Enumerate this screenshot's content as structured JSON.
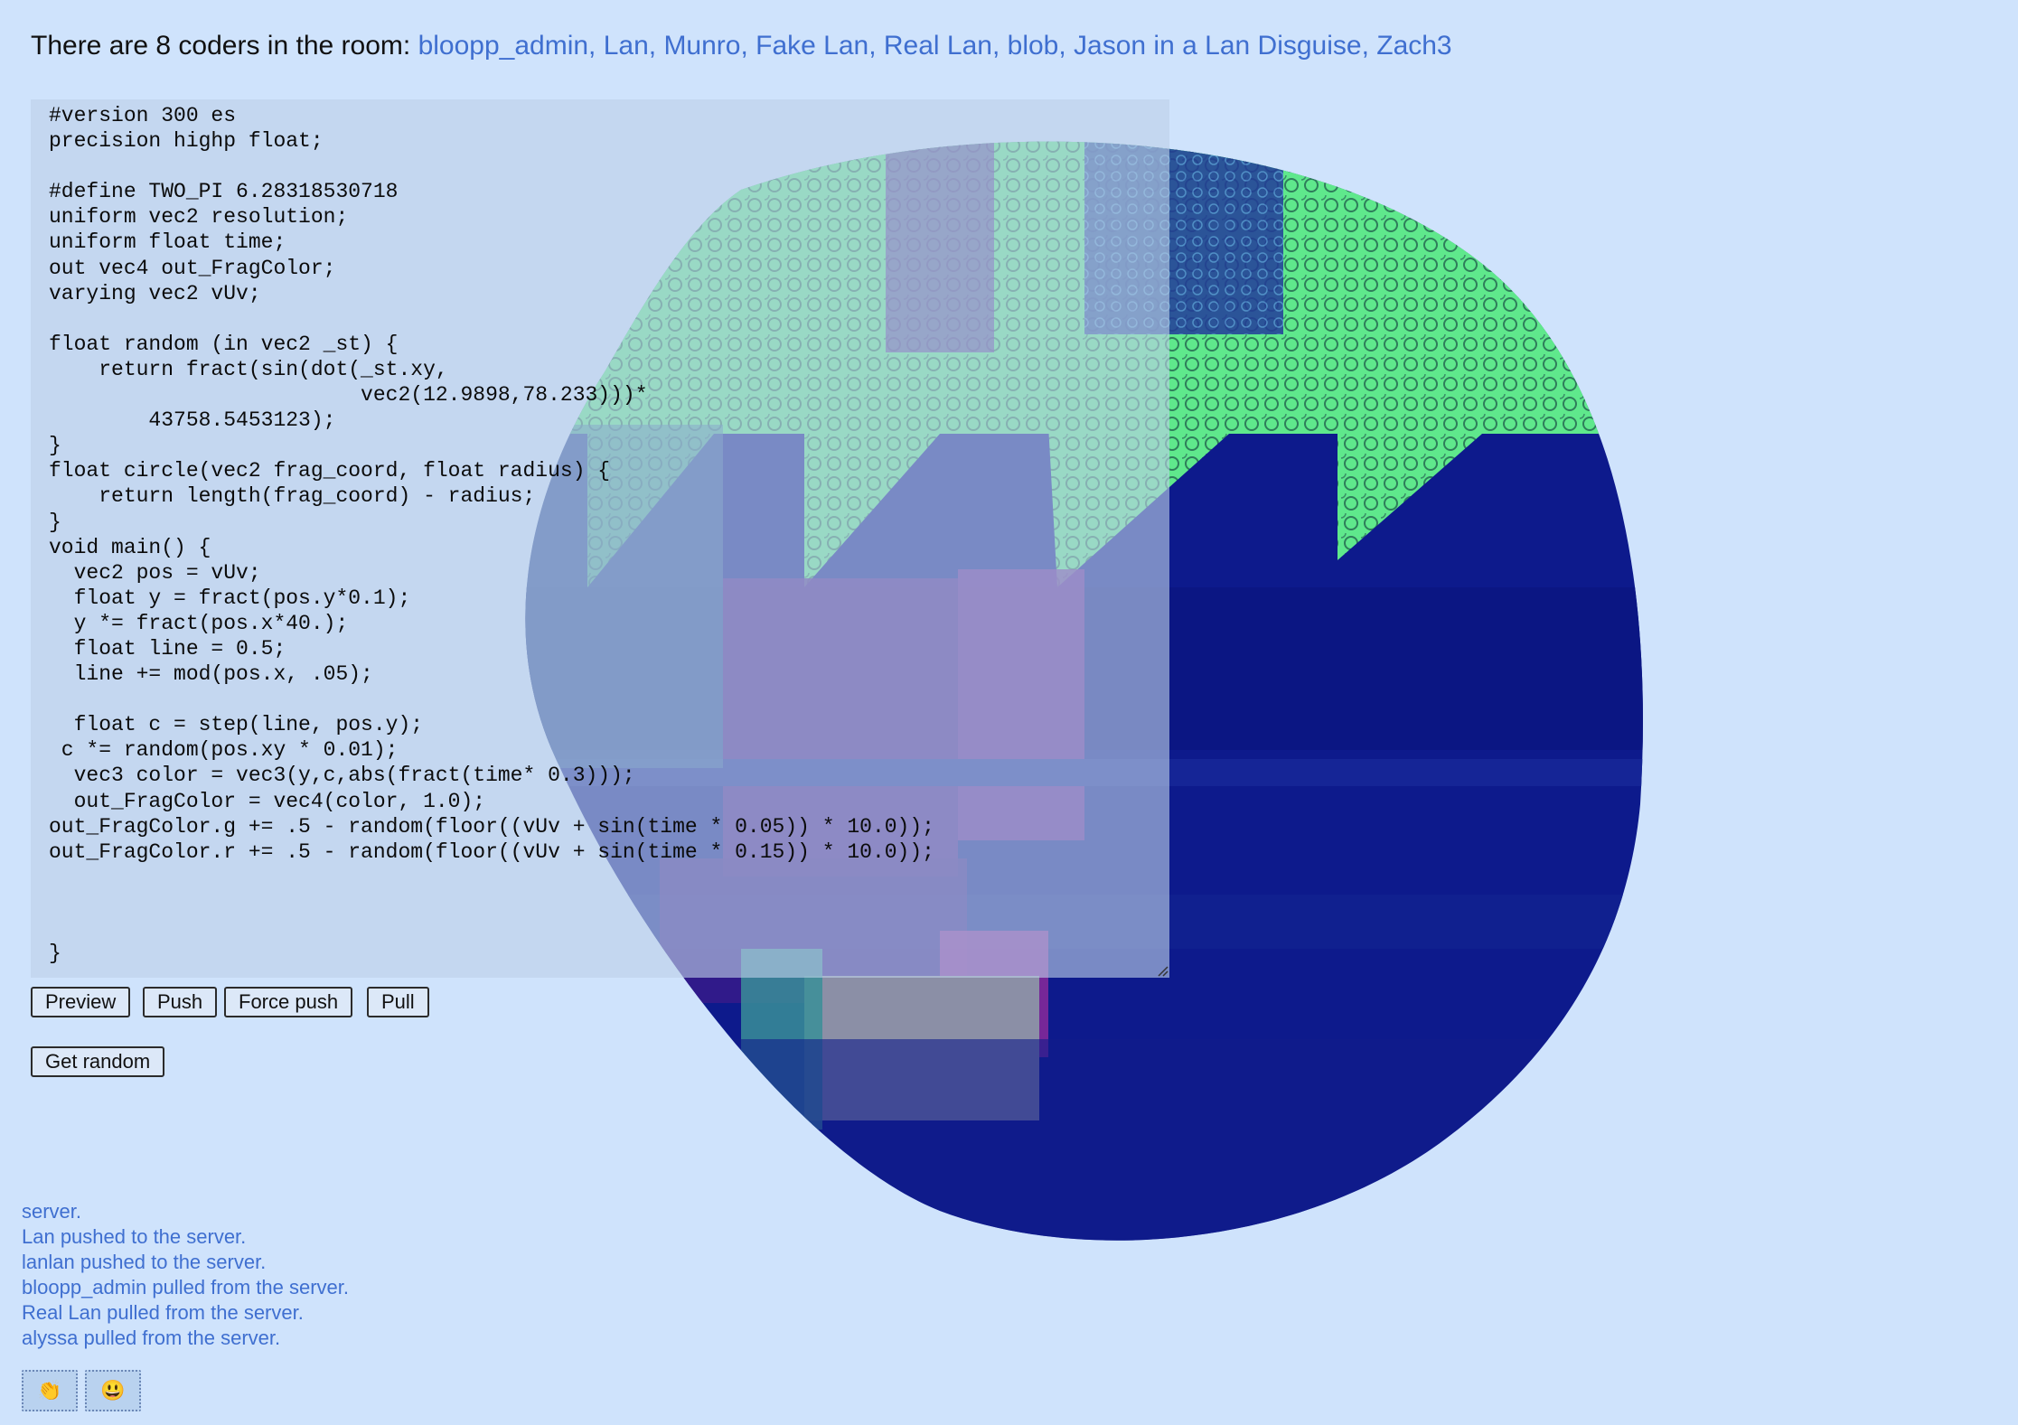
{
  "header": {
    "prefix": "There are 8 coders in the room:",
    "names": "bloopp_admin, Lan, Munro, Fake Lan, Real Lan, blob, Jason in a Lan Disguise, Zach3"
  },
  "editor": {
    "lines": [
      "#version 300 es",
      "precision highp float;",
      "",
      "#define TWO_PI 6.28318530718",
      "uniform vec2 resolution;",
      "uniform float time;",
      "out vec4 out_FragColor;",
      "varying vec2 vUv;",
      "",
      "float random (in vec2 _st) {",
      "    return fract(sin(dot(_st.xy,",
      "                         vec2(12.9898,78.233)))*",
      "        43758.5453123);",
      "}",
      "float circle(vec2 frag_coord, float radius) {",
      "    return length(frag_coord) - radius;",
      "}",
      "void main() {",
      "  vec2 pos = vUv;",
      "  float y = fract(pos.y*0.1);",
      "  y *= fract(pos.x*40.);",
      "  float line = 0.5;",
      "  line += mod(pos.x, .05);",
      "",
      "  float c = step(line, pos.y);",
      " c *= random(pos.xy * 0.01);",
      "  vec3 color = vec3(y,c,abs(fract(time* 0.3)));",
      "  out_FragColor = vec4(color, 1.0);",
      "out_FragColor.g += .5 - random(floor((vUv + sin(time * 0.05)) * 10.0));",
      "out_FragColor.r += .5 - random(floor((vUv + sin(time * 0.15)) * 10.0));",
      "",
      "",
      "",
      "}"
    ]
  },
  "buttons": {
    "preview": "Preview",
    "push": "Push",
    "force_push": "Force push",
    "pull": "Pull",
    "get_random": "Get random"
  },
  "log": [
    "server.",
    "Lan pushed to the server.",
    "lanlan pushed to the server.",
    "bloopp_admin pulled from the server.",
    "Real Lan pulled from the server.",
    "alyssa pulled from the server."
  ],
  "reactions": {
    "clap_icon": "clap-icon",
    "smiley_icon": "smiley-icon"
  },
  "colors": {
    "background": "#cfe3fc",
    "link": "#3f6fd0",
    "blob_green": "#5fe88c",
    "blob_navy": "#0d1a8c",
    "blob_purple": "#4a1a8c",
    "blob_magenta": "#8a2a9a"
  }
}
